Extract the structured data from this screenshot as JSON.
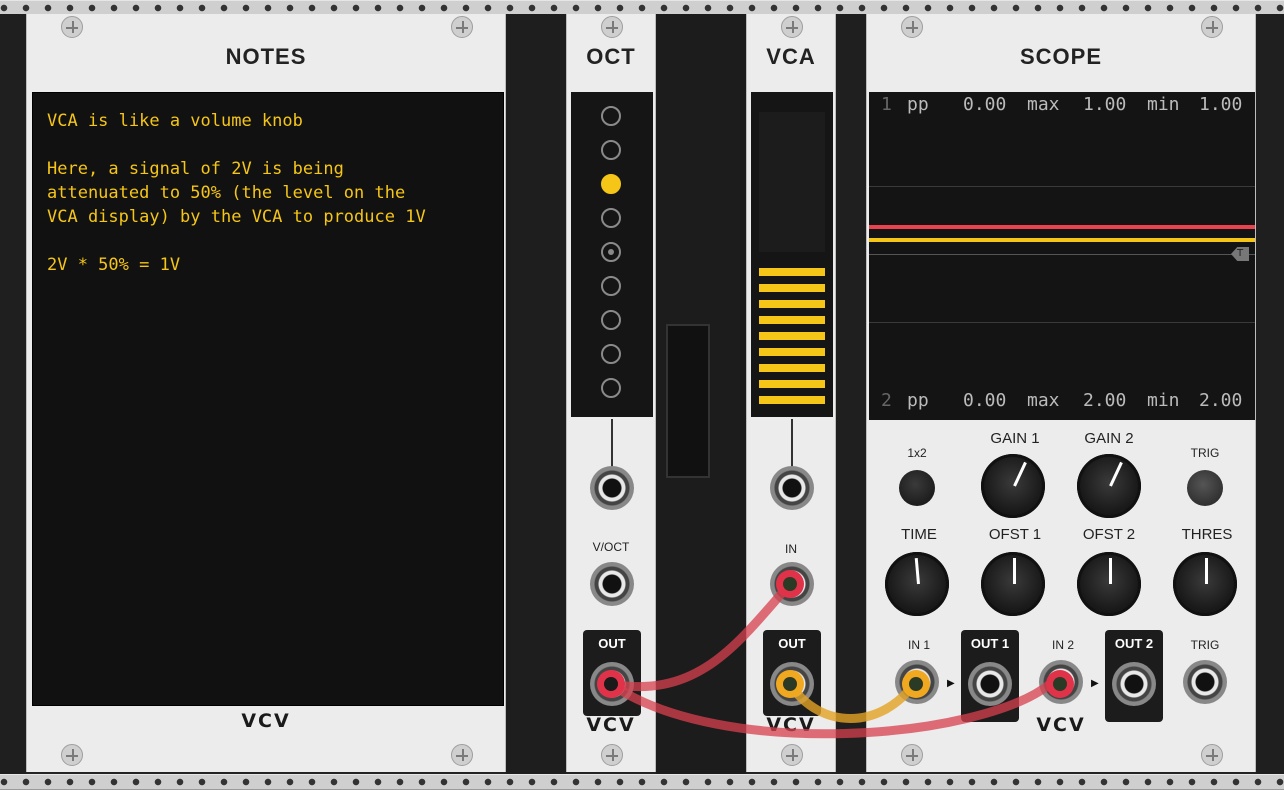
{
  "notes": {
    "title": "NOTES",
    "text": "VCA is like a volume knob\n\nHere, a signal of 2V is being\nattenuated to 50% (the level on the\nVCA display) by the VCA to produce 1V\n\n2V * 50% = 1V",
    "brand": "VCV"
  },
  "oct": {
    "title": "OCT",
    "input_label": "V/OCT",
    "output_label": "OUT",
    "brand": "VCV",
    "leds": [
      "off",
      "off",
      "on",
      "off",
      "mid",
      "off",
      "off",
      "off",
      "off"
    ]
  },
  "vca": {
    "title": "VCA",
    "input_label": "IN",
    "output_label": "OUT",
    "brand": "VCV",
    "level": 0.5
  },
  "scope": {
    "title": "SCOPE",
    "brand": "VCV",
    "ch1": {
      "num": "1",
      "pp_label": "pp",
      "pp": "0.00",
      "max_label": "max",
      "max": "1.00",
      "min_label": "min",
      "min": "1.00"
    },
    "ch2": {
      "num": "2",
      "pp_label": "pp",
      "pp": "0.00",
      "max_label": "max",
      "max": "2.00",
      "min_label": "min",
      "min": "2.00"
    },
    "trigger_marker": "T",
    "controls": {
      "x1x2": "1x2",
      "gain1": "GAIN 1",
      "gain2": "GAIN 2",
      "trig": "TRIG",
      "time": "TIME",
      "ofst1": "OFST 1",
      "ofst2": "OFST 2",
      "thres": "THRES",
      "in1": "IN 1",
      "out1": "OUT 1",
      "in2": "IN 2",
      "out2": "OUT 2",
      "trig_in": "TRIG"
    }
  },
  "colors": {
    "display_text": "#f5c518",
    "cable_red": "#e0334a",
    "cable_yellow": "#f0a820",
    "trace1": "#f5c518",
    "trace2": "#e8434f"
  }
}
